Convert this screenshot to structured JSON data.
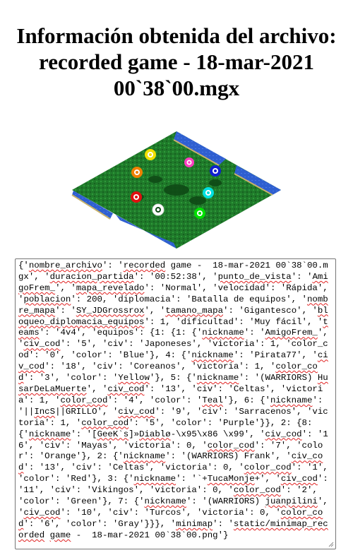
{
  "page": {
    "title_lines": [
      "Información obtenida del archivo:",
      "recorded game - 18-mar-2021",
      "00`38`00.mgx"
    ]
  },
  "minimap": {
    "players": [
      {
        "color": "#f0e000",
        "label": "yellow"
      },
      {
        "color": "#ff3fc0",
        "label": "purple"
      },
      {
        "color": "#f08000",
        "label": "orange"
      },
      {
        "color": "#1020d0",
        "label": "blue"
      },
      {
        "color": "#00e0e0",
        "label": "teal"
      },
      {
        "color": "#e01010",
        "label": "red"
      },
      {
        "color": "#ffffff",
        "label": "gray"
      },
      {
        "color": "#00e000",
        "label": "green"
      }
    ]
  },
  "output": {
    "segments": [
      {
        "t": "{'",
        "u": false
      },
      {
        "t": "nombre_archivo",
        "u": true
      },
      {
        "t": "': '",
        "u": false
      },
      {
        "t": "recorded",
        "u": true
      },
      {
        "t": " game -  18-mar-2021 00`38`00.mgx', '",
        "u": false
      },
      {
        "t": "duracion_partida",
        "u": true
      },
      {
        "t": "': '00:52:38', '",
        "u": false
      },
      {
        "t": "punto_de_vista",
        "u": true
      },
      {
        "t": "': '",
        "u": false
      },
      {
        "t": "AmigoFrem_",
        "u": true
      },
      {
        "t": "', '",
        "u": false
      },
      {
        "t": "mapa_revelado",
        "u": true
      },
      {
        "t": "': 'Normal', 'velocidad': 'Rápida', '",
        "u": false
      },
      {
        "t": "poblacion",
        "u": true
      },
      {
        "t": "': 200, 'diplomacia': 'Batalla de equipos', '",
        "u": false
      },
      {
        "t": "nombre_mapa",
        "u": true
      },
      {
        "t": "': '",
        "u": false
      },
      {
        "t": "SY_JDGrossrox",
        "u": true
      },
      {
        "t": "', '",
        "u": false
      },
      {
        "t": "tamano_mapa",
        "u": true
      },
      {
        "t": "': 'Gigantesco', '",
        "u": false
      },
      {
        "t": "bloqueo_diplomacia_equipos",
        "u": true
      },
      {
        "t": "': 1, 'dificultad': 'Muy fácil', '",
        "u": false
      },
      {
        "t": "teams",
        "u": true
      },
      {
        "t": "': '4v4', 'equipos': {1: {1: {'",
        "u": false
      },
      {
        "t": "nickname",
        "u": true
      },
      {
        "t": "': '",
        "u": false
      },
      {
        "t": "AmigoFrem_",
        "u": true
      },
      {
        "t": "', '",
        "u": false
      },
      {
        "t": "civ_cod",
        "u": true
      },
      {
        "t": "': '5', 'civ': 'Japoneses', 'victoria': 1, 'color_cod': '0', 'color': 'Blue'}, 4: {'",
        "u": false
      },
      {
        "t": "nickname",
        "u": true
      },
      {
        "t": "': 'Pirata77', '",
        "u": false
      },
      {
        "t": "civ_cod",
        "u": true
      },
      {
        "t": "': '18', 'civ': 'Coreanos', 'victoria': 1, '",
        "u": false
      },
      {
        "t": "color_cod",
        "u": true
      },
      {
        "t": "': '3', 'color': '",
        "u": false
      },
      {
        "t": "Yellow",
        "u": true
      },
      {
        "t": "'}, 5: {'",
        "u": false
      },
      {
        "t": "nickname",
        "u": true
      },
      {
        "t": "': '(WARRIORS) ",
        "u": false
      },
      {
        "t": "HusarDeLaMuerte",
        "u": true
      },
      {
        "t": "', '",
        "u": false
      },
      {
        "t": "civ_cod",
        "u": true
      },
      {
        "t": "': '13', 'civ': 'Celtas', 'victoria': 1, '",
        "u": false
      },
      {
        "t": "color_cod",
        "u": true
      },
      {
        "t": "': '4', 'color': '",
        "u": false
      },
      {
        "t": "Teal",
        "u": true
      },
      {
        "t": "'}, 6: {'",
        "u": false
      },
      {
        "t": "nickname",
        "u": true
      },
      {
        "t": "': '||",
        "u": false
      },
      {
        "t": "IncS",
        "u": true
      },
      {
        "t": "||GRILLO', '",
        "u": false
      },
      {
        "t": "civ_cod",
        "u": true
      },
      {
        "t": "': '9', 'civ': 'Sarracenos', 'victoria': 1, '",
        "u": false
      },
      {
        "t": "color_cod",
        "u": true
      },
      {
        "t": "': '5', 'color': 'Purple'}}, 2: {8: {'",
        "u": false
      },
      {
        "t": "nickname",
        "u": true
      },
      {
        "t": "': '[",
        "u": false
      },
      {
        "t": "GeeK`s",
        "u": true
      },
      {
        "t": "]»",
        "u": false
      },
      {
        "t": "Diablø",
        "u": true
      },
      {
        "t": "-\\x95\\x86 \\x99', '",
        "u": false
      },
      {
        "t": "civ_cod",
        "u": true
      },
      {
        "t": "': '16', 'civ': 'Mayas', 'victoria': 0, '",
        "u": false
      },
      {
        "t": "color_cod",
        "u": true
      },
      {
        "t": "': '7', 'color': 'Orange'}, 2: {'",
        "u": false
      },
      {
        "t": "nickname",
        "u": true
      },
      {
        "t": "': '(WARRIORS) Frank', '",
        "u": false
      },
      {
        "t": "civ_cod",
        "u": true
      },
      {
        "t": "': '13', 'civ': 'Celtas', 'victoria': 0, '",
        "u": false
      },
      {
        "t": "color_cod",
        "u": true
      },
      {
        "t": "': '1', 'color': 'Red'}, 3: {'",
        "u": false
      },
      {
        "t": "nickname",
        "u": true
      },
      {
        "t": "': '`+",
        "u": false
      },
      {
        "t": "TucaMonje",
        "u": true
      },
      {
        "t": "+', '",
        "u": false
      },
      {
        "t": "civ_cod",
        "u": true
      },
      {
        "t": "': '11', 'civ': 'Vikingos', 'victoria': 0, '",
        "u": false
      },
      {
        "t": "color_cod",
        "u": true
      },
      {
        "t": "': '2', 'color': 'Green'}, 7: {'",
        "u": false
      },
      {
        "t": "nickname",
        "u": true
      },
      {
        "t": "': '(WARRIORS) ",
        "u": false
      },
      {
        "t": "juanpilini",
        "u": true
      },
      {
        "t": "', '",
        "u": false
      },
      {
        "t": "civ_cod",
        "u": true
      },
      {
        "t": "': '10', 'civ': 'Turcos', 'victoria': 0, '",
        "u": false
      },
      {
        "t": "color_cod",
        "u": true
      },
      {
        "t": "': '6', 'color': 'Gray'}}}, '",
        "u": false
      },
      {
        "t": "minimap",
        "u": true
      },
      {
        "t": "': '",
        "u": false
      },
      {
        "t": "static/minimap_recorded",
        "u": true
      },
      {
        "t": " ",
        "u": false
      },
      {
        "t": "game",
        "u": true
      },
      {
        "t": " -  18-mar-2021 00`38`00.png'}",
        "u": false
      }
    ]
  }
}
